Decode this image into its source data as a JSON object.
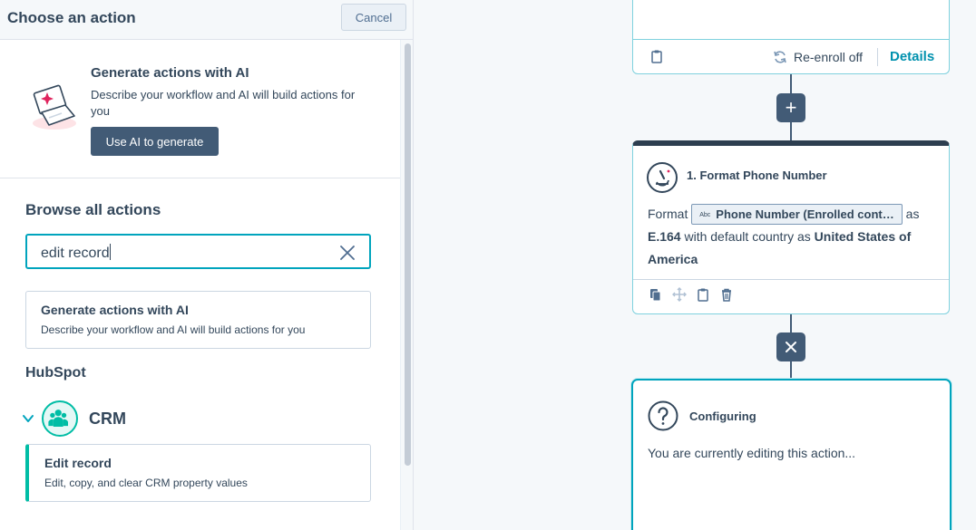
{
  "panel": {
    "title": "Choose an action",
    "cancel_label": "Cancel"
  },
  "ai_promo": {
    "title": "Generate actions with AI",
    "description": "Describe your workflow and AI will build actions for you",
    "button_label": "Use AI to generate"
  },
  "browse": {
    "title": "Browse all actions",
    "search_value": "edit record"
  },
  "results": {
    "ai_card": {
      "title": "Generate actions with AI",
      "description": "Describe your workflow and AI will build actions for you"
    },
    "group_title": "HubSpot",
    "category": {
      "label": "CRM",
      "icon": "people-icon",
      "accent": "#00bda5"
    },
    "items": [
      {
        "title": "Edit record",
        "description": "Edit, copy, and clear CRM property values"
      }
    ]
  },
  "canvas": {
    "top_node": {
      "reenroll_text": "Re-enroll off",
      "details_label": "Details"
    },
    "add_button": "+",
    "format_node": {
      "title": "1. Format Phone Number",
      "prefix": "Format",
      "token_abc": "Abc",
      "token_label": "Phone Number (Enrolled cont…",
      "as1": "as",
      "format_value": "E.164",
      "middle": "with default country as",
      "country": "United States of America"
    },
    "config_node": {
      "title": "Configuring",
      "body": "You are currently editing this action..."
    }
  },
  "colors": {
    "primary_dark": "#425b76",
    "teal": "#00a4bd",
    "link": "#0091ae",
    "accent": "#00bda5"
  }
}
